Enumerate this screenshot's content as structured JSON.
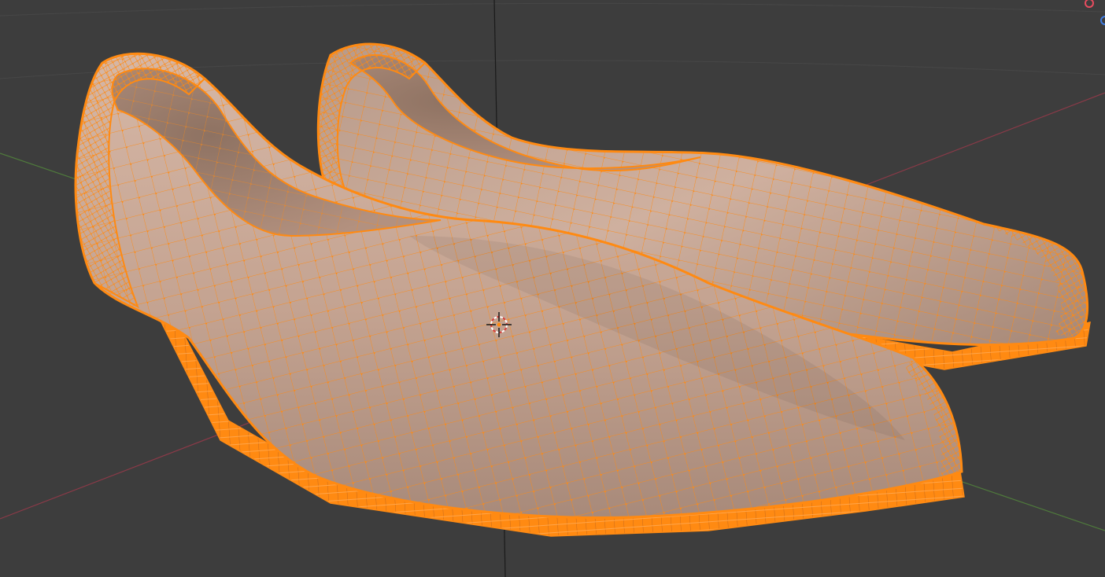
{
  "app": {
    "name": "",
    "mode": "edit-mesh",
    "view": "3d-viewport"
  },
  "viewport": {
    "background": "#3d3d3d",
    "grid_color": "#474747",
    "axis_x_color": "#8a3a48",
    "axis_y_color": "#4f7a3c",
    "axis_z_color": "#1a1a1a",
    "selection_color": "#ff8a12",
    "surface_color": "#c4a391"
  },
  "objects": [
    {
      "name_shown": "",
      "kind": "shoe-mesh-back",
      "selected": true
    },
    {
      "name_shown": "",
      "kind": "shoe-mesh-front",
      "selected": true
    }
  ],
  "cursor": {
    "icon": "3d-cursor-icon"
  },
  "gizmo": {
    "x_dot_color": "#e84c5f",
    "y_dot_color": "#3f7be0"
  }
}
